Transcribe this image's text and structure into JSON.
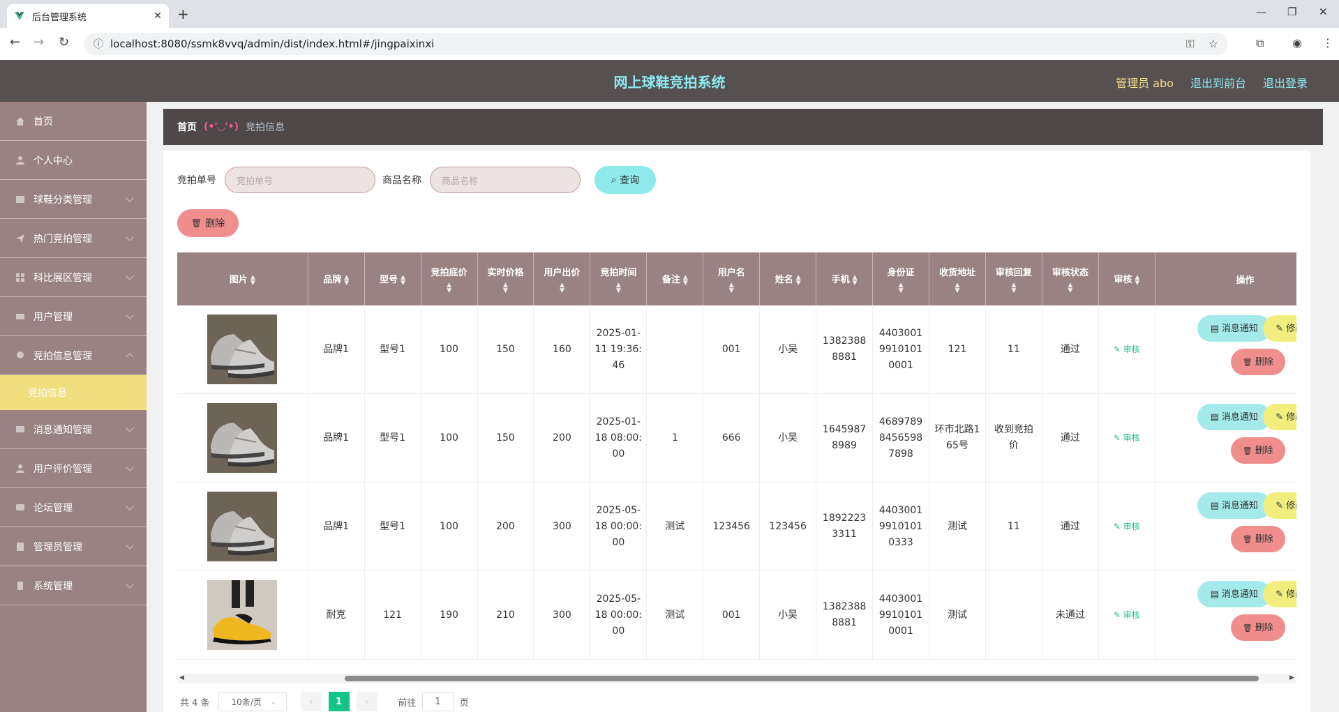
{
  "browser": {
    "tab_title": "后台管理系统",
    "url": "localhost:8080/ssmk8vvq/admin/dist/index.html#/jingpaixinxi"
  },
  "header": {
    "system_title": "网上球鞋竞拍系统",
    "admin_label": "管理员 abo",
    "to_front": "退出到前台",
    "logout": "退出登录"
  },
  "sidebar": {
    "items": [
      {
        "label": "首页"
      },
      {
        "label": "个人中心"
      },
      {
        "label": "球鞋分类管理"
      },
      {
        "label": "热门竞拍管理"
      },
      {
        "label": "科比展区管理"
      },
      {
        "label": "用户管理"
      },
      {
        "label": "竞拍信息管理"
      },
      {
        "label": "消息通知管理"
      },
      {
        "label": "用户评价管理"
      },
      {
        "label": "论坛管理"
      },
      {
        "label": "管理员管理"
      },
      {
        "label": "系统管理"
      }
    ],
    "active_sub": "竞拍信息"
  },
  "breadcrumb": {
    "home": "首页",
    "separator": "(•'◡'•)",
    "current": "竞拍信息"
  },
  "search": {
    "label1": "竞拍单号",
    "placeholder1": "竞拍单号",
    "label2": "商品名称",
    "placeholder2": "商品名称",
    "query_btn": "查询",
    "delete_btn": "删除"
  },
  "table": {
    "headers": [
      "图片",
      "品牌",
      "型号",
      "竞拍底价",
      "实时价格",
      "用户出价",
      "竞拍时间",
      "备注",
      "用户名",
      "姓名",
      "手机",
      "身份证",
      "收货地址",
      "审核回复",
      "审核状态",
      "审核",
      "操作"
    ],
    "rows": [
      {
        "brand": "品牌1",
        "model": "型号1",
        "base": "100",
        "realtime": "150",
        "bid": "160",
        "time": "2025-01-11 19:36:46",
        "remark": "",
        "user": "001",
        "name": "小吴",
        "phone": "13823888881",
        "idcard": "440300199101010001",
        "address": "121",
        "reply": "11",
        "status": "通过"
      },
      {
        "brand": "品牌1",
        "model": "型号1",
        "base": "100",
        "realtime": "150",
        "bid": "200",
        "time": "2025-01-18 08:00:00",
        "remark": "1",
        "user": "666",
        "name": "小吴",
        "phone": "16459878989",
        "idcard": "468978984565987898",
        "address": "环市北路165号",
        "reply": "收到竞拍价",
        "status": "通过"
      },
      {
        "brand": "品牌1",
        "model": "型号1",
        "base": "100",
        "realtime": "200",
        "bid": "300",
        "time": "2025-05-18 00:00:00",
        "remark": "测试",
        "user": "123456",
        "name": "123456",
        "phone": "18922233311",
        "idcard": "440300199101010333",
        "address": "测试",
        "reply": "11",
        "status": "通过"
      },
      {
        "brand": "耐克",
        "model": "121",
        "base": "190",
        "realtime": "210",
        "bid": "300",
        "time": "2025-05-18 00:00:00",
        "remark": "测试",
        "user": "001",
        "name": "小吴",
        "phone": "13823888881",
        "idcard": "440300199101010001",
        "address": "测试",
        "reply": "",
        "status": "未通过"
      }
    ],
    "audit_link": "审核",
    "op_notify": "消息通知",
    "op_edit": "修改",
    "op_delete": "删除"
  },
  "pagination": {
    "total": "共 4 条",
    "page_size": "10条/页",
    "current_page": "1",
    "goto_label": "前往",
    "goto_value": "1",
    "page_suffix": "页"
  },
  "colors": {
    "header_bg": "#565050",
    "sidebar_bg": "#9a8283",
    "accent_cyan": "#8ee9eb",
    "accent_yellow": "#f1ee7e",
    "accent_red": "#f08d8d",
    "active_page": "#13c48b"
  }
}
